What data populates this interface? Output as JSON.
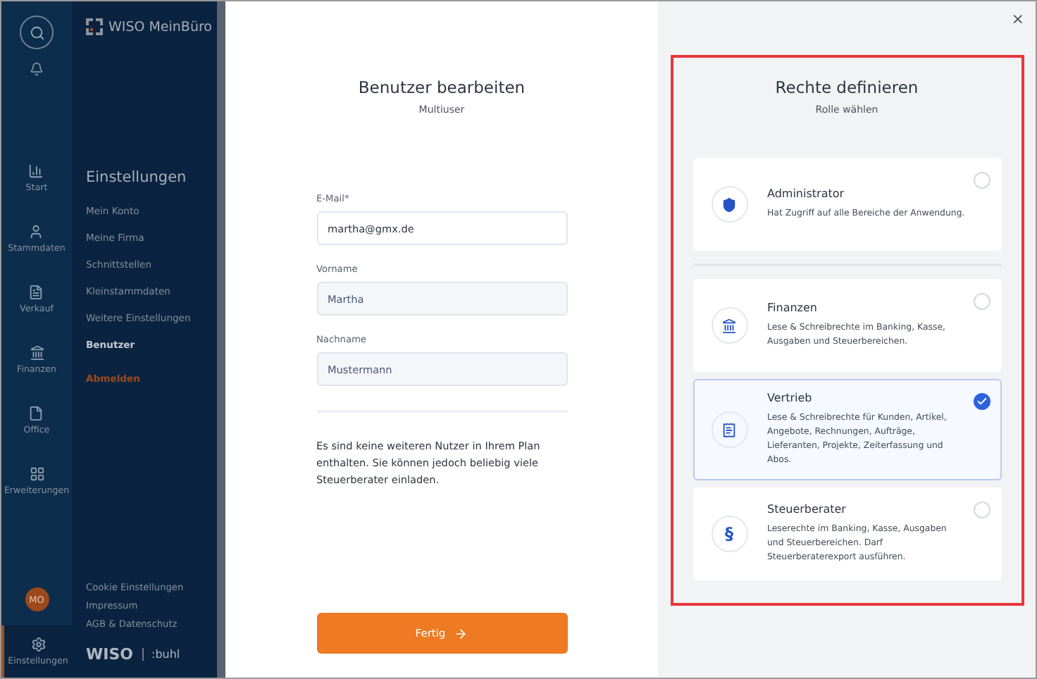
{
  "rail": {
    "items": [
      {
        "label": "Start",
        "selected": false
      },
      {
        "label": "Stammdaten",
        "selected": false
      },
      {
        "label": "Verkauf",
        "selected": false
      },
      {
        "label": "Finanzen",
        "selected": false
      },
      {
        "label": "Office",
        "selected": false
      },
      {
        "label": "Erweiterungen",
        "selected": false
      }
    ],
    "avatar": "MO",
    "settings": {
      "label": "Einstellungen",
      "selected": true
    }
  },
  "menu": {
    "logo": "WISO MeinBüro",
    "title": "Einstellungen",
    "items": [
      {
        "label": "Mein Konto",
        "selected": false
      },
      {
        "label": "Meine Firma",
        "selected": false
      },
      {
        "label": "Schnittstellen",
        "selected": false
      },
      {
        "label": "Kleinstammdaten",
        "selected": false
      },
      {
        "label": "Weitere Einstellungen",
        "selected": false
      },
      {
        "label": "Benutzer",
        "selected": true
      }
    ],
    "logout": "Abmelden",
    "footer_links": [
      "Cookie Einstellungen",
      "Impressum",
      "AGB & Datenschutz"
    ],
    "footer_logo": "WISO",
    "footer_brand": ":buhl"
  },
  "form": {
    "title": "Benutzer bearbeiten",
    "subtitle": "Multiuser",
    "fields": [
      {
        "label": "E-Mail*",
        "value": "martha@gmx.de",
        "disabled": false
      },
      {
        "label": "Vorname",
        "value": "Martha",
        "disabled": true
      },
      {
        "label": "Nachname",
        "value": "Mustermann",
        "disabled": true
      }
    ],
    "note": "Es sind keine weiteren Nutzer in Ihrem Plan enthalten. Sie können jedoch beliebig viele Steuerberater einladen.",
    "button": "Fertig"
  },
  "roles": {
    "title": "Rechte definieren",
    "subtitle": "Rolle wählen",
    "items": [
      {
        "name": "Administrator",
        "description": "Hat Zugriff auf alle Bereiche der Anwendung.",
        "selected": false
      },
      {
        "name": "Finanzen",
        "description": "Lese & Schreibrechte im Banking, Kasse, Ausgaben und Steuerbereichen.",
        "selected": false
      },
      {
        "name": "Vertrieb",
        "description": "Lese & Schreibrechte für Kunden, Artikel, Angebote, Rechnungen, Aufträge, Lieferanten, Projekte, Zeiterfassung und Abos.",
        "selected": true
      },
      {
        "name": "Steuerberater",
        "description": "Leserechte im Banking, Kasse, Ausgaben und Steuerbereichen. Darf Steuerberaterexport ausführen.",
        "selected": false,
        "icon_text": "§"
      }
    ]
  },
  "close": "×"
}
